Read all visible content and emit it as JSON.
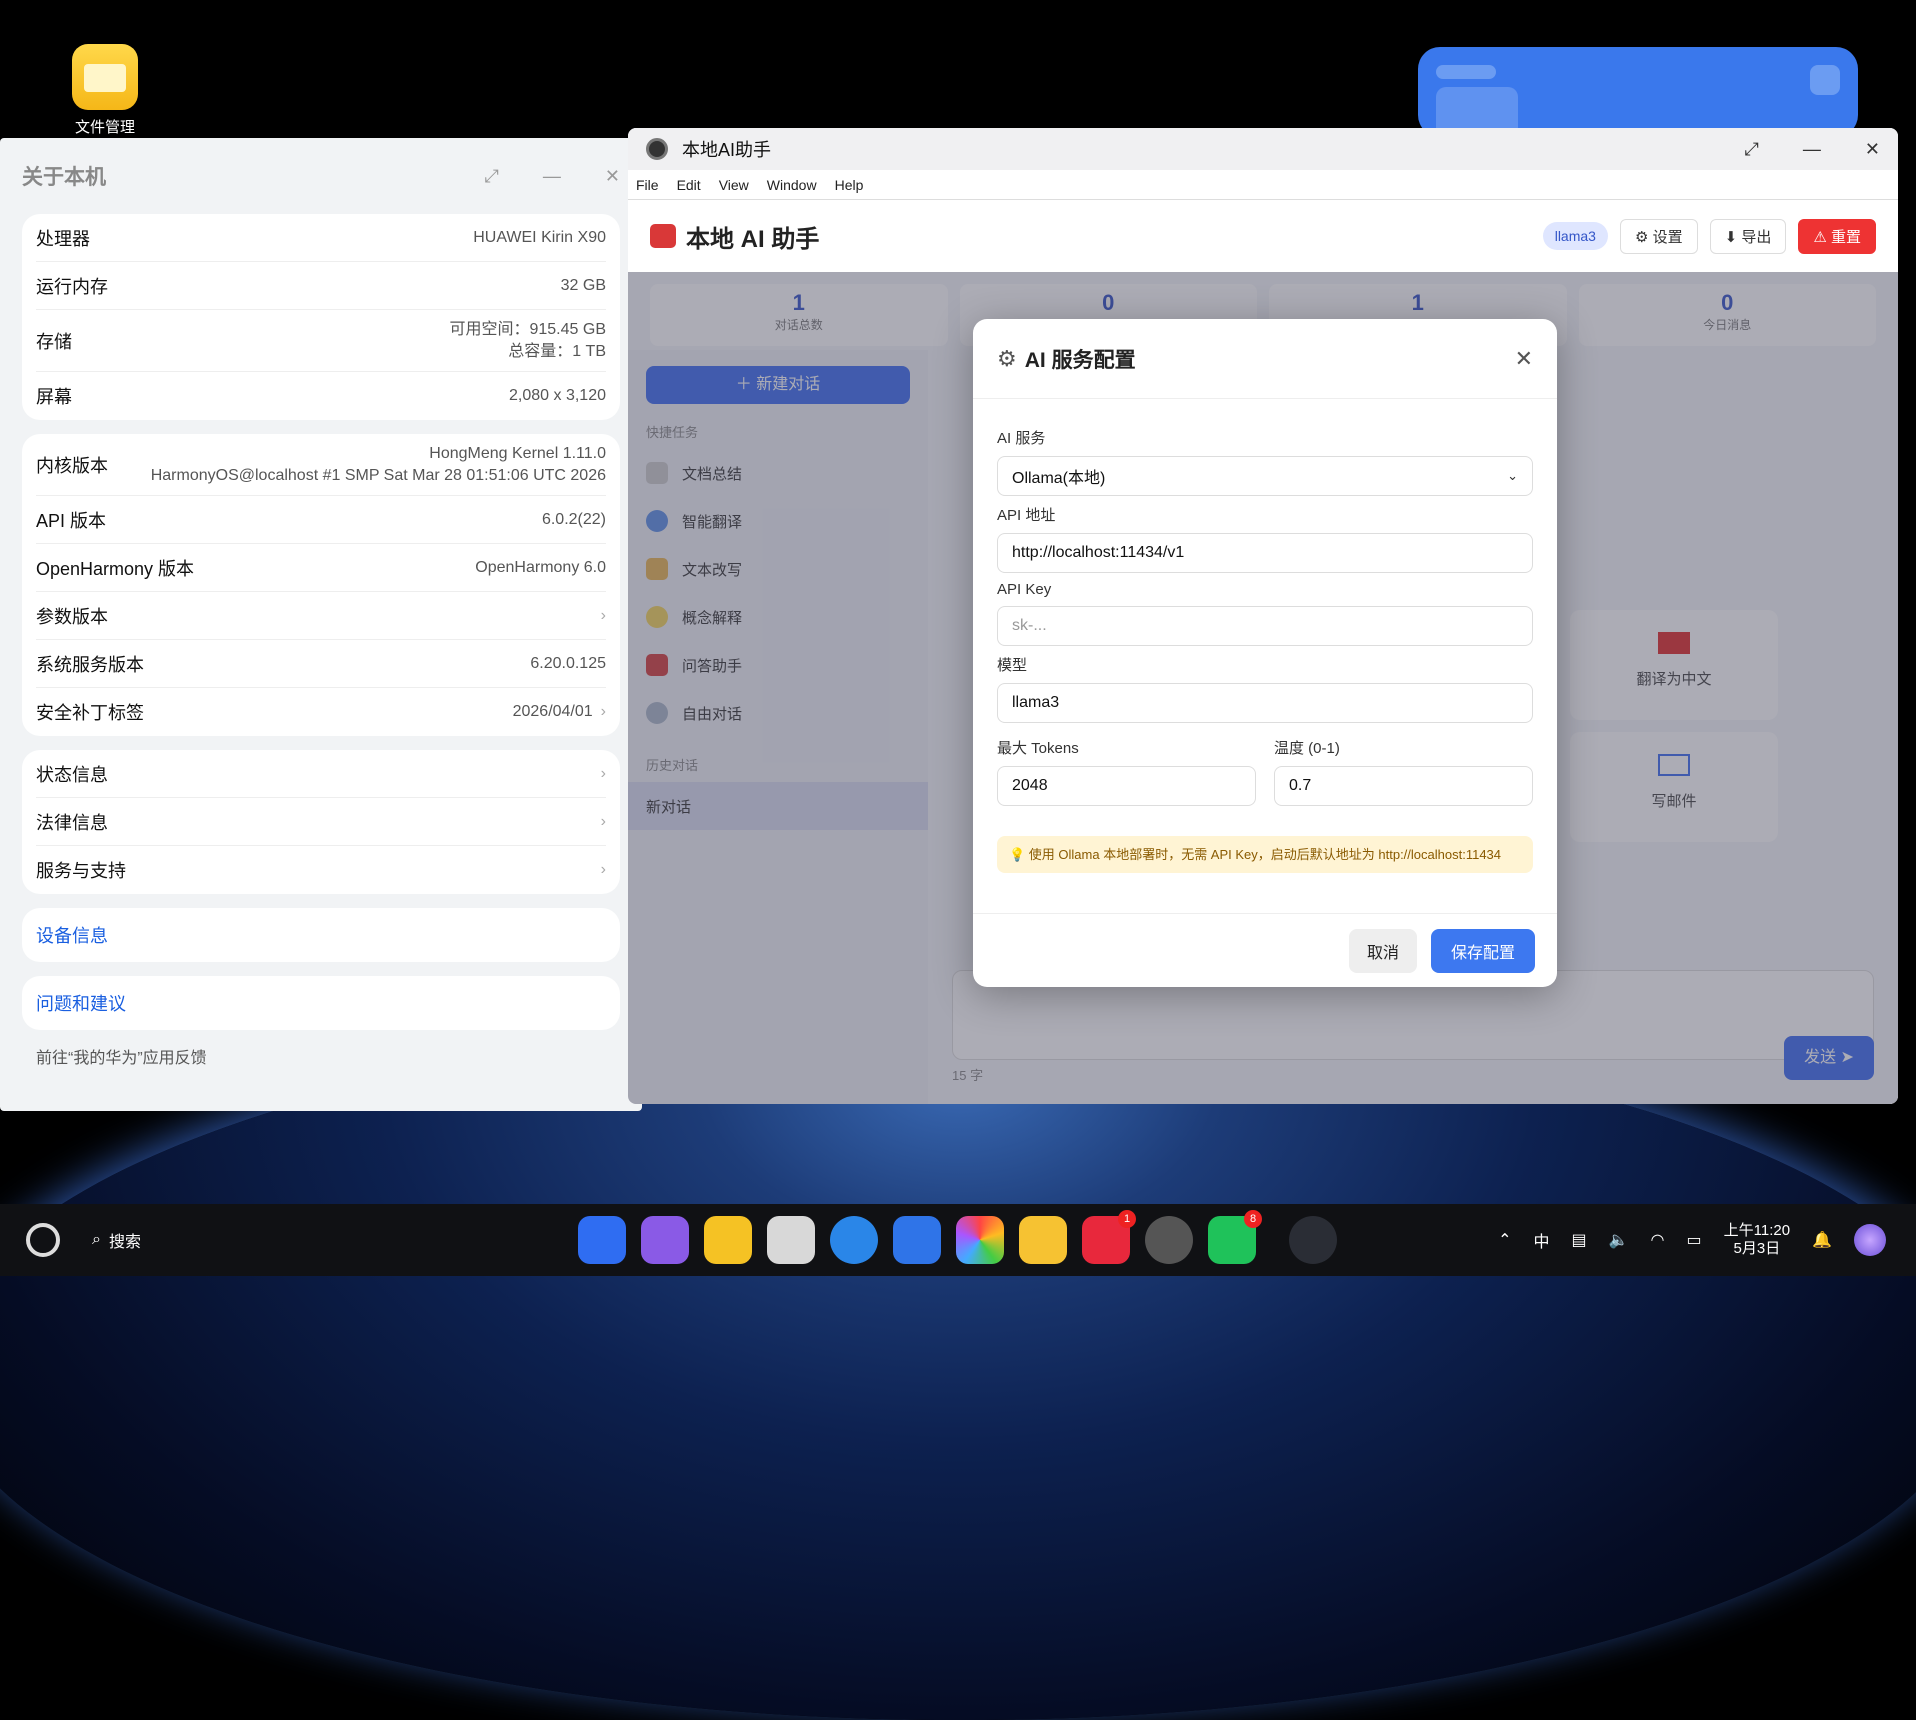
{
  "desktop": {
    "file_manager_label": "文件管理"
  },
  "about": {
    "title": "关于本机",
    "hw": [
      {
        "k": "处理器",
        "v": "HUAWEI Kirin X90"
      },
      {
        "k": "运行内存",
        "v": "32 GB"
      },
      {
        "k": "存储",
        "v": "可用空间：915.45 GB",
        "v2": "总容量：1 TB"
      },
      {
        "k": "屏幕",
        "v": "2,080 x 3,120"
      }
    ],
    "sw": [
      {
        "k": "内核版本",
        "v": "HongMeng Kernel 1.11.0",
        "v2": "HarmonyOS@localhost #1 SMP Sat Mar 28 01:51:06 UTC 2026"
      },
      {
        "k": "API 版本",
        "v": "6.0.2(22)"
      },
      {
        "k": "OpenHarmony 版本",
        "v": "OpenHarmony 6.0"
      },
      {
        "k": "参数版本",
        "v": ""
      },
      {
        "k": "系统服务版本",
        "v": "6.20.0.125"
      },
      {
        "k": "安全补丁标签",
        "v": "2026/04/01"
      }
    ],
    "info": [
      "状态信息",
      "法律信息",
      "服务与支持"
    ],
    "device_info": "设备信息",
    "feedback": "问题和建议",
    "feedback_note": "前往“我的华为”应用反馈"
  },
  "ai": {
    "window_title": "本地AI助手",
    "menu": [
      "File",
      "Edit",
      "View",
      "Window",
      "Help"
    ],
    "header_title": "本地 AI 助手",
    "model_pill": "llama3",
    "settings_btn": "设置",
    "export_btn": "导出",
    "reset_btn": "重置",
    "stats": [
      {
        "n": "1",
        "l": "对话总数"
      },
      {
        "n": "0",
        "l": ""
      },
      {
        "n": "1",
        "l": ""
      },
      {
        "n": "0",
        "l": "今日消息"
      }
    ],
    "new_chat": "新建对话",
    "quick_title": "快捷任务",
    "quick": [
      "文档总结",
      "智能翻译",
      "文本改写",
      "概念解释",
      "问答助手",
      "自由对话"
    ],
    "history_title": "历史对话",
    "history": [
      "新对话"
    ],
    "tcard1": "翻译为中文",
    "tcard2": "写邮件",
    "char_count": "15 字",
    "send": "发送 ➤"
  },
  "modal": {
    "title": "AI 服务配置",
    "service_label": "AI 服务",
    "service_value": "Ollama(本地)",
    "url_label": "API 地址",
    "url_value": "http://localhost:11434/v1",
    "key_label": "API Key",
    "key_placeholder": "sk-...",
    "model_label": "模型",
    "model_value": "llama3",
    "tokens_label": "最大 Tokens",
    "tokens_value": "2048",
    "temp_label": "温度 (0-1)",
    "temp_value": "0.7",
    "tip": "💡 使用 Ollama 本地部署时，无需 API Key，启动后默认地址为 http://localhost:11434",
    "cancel": "取消",
    "save": "保存配置"
  },
  "taskbar": {
    "search": "搜索",
    "time": "上午11:20",
    "date": "5月3日",
    "ime": "中",
    "badge_app": "1",
    "badge_wechat": "8"
  }
}
